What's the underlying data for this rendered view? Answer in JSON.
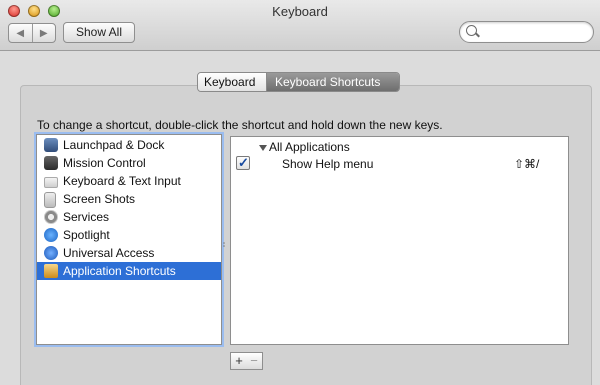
{
  "window": {
    "title": "Keyboard"
  },
  "toolbar": {
    "show_all_label": "Show All",
    "search_placeholder": ""
  },
  "tabs": [
    {
      "label": "Keyboard",
      "selected": false
    },
    {
      "label": "Keyboard Shortcuts",
      "selected": true
    }
  ],
  "instruction": "To change a shortcut, double-click the shortcut and hold down the new keys.",
  "categories": [
    {
      "label": "Launchpad & Dock",
      "icon": "launchpad-icon"
    },
    {
      "label": "Mission Control",
      "icon": "mission-control-icon"
    },
    {
      "label": "Keyboard & Text Input",
      "icon": "keyboard-icon"
    },
    {
      "label": "Screen Shots",
      "icon": "screenshot-icon"
    },
    {
      "label": "Services",
      "icon": "services-icon"
    },
    {
      "label": "Spotlight",
      "icon": "spotlight-icon"
    },
    {
      "label": "Universal Access",
      "icon": "universal-access-icon"
    },
    {
      "label": "Application Shortcuts",
      "icon": "application-shortcuts-icon",
      "selected": true
    }
  ],
  "shortcuts": {
    "group_label": "All Applications",
    "items": [
      {
        "checked": true,
        "label": "Show Help menu",
        "keys": "⇧⌘/"
      }
    ]
  },
  "buttons": {
    "add": "+",
    "remove": "−"
  },
  "colors": {
    "selection": "#2d6fd6",
    "accent": "#9bbdf0"
  }
}
